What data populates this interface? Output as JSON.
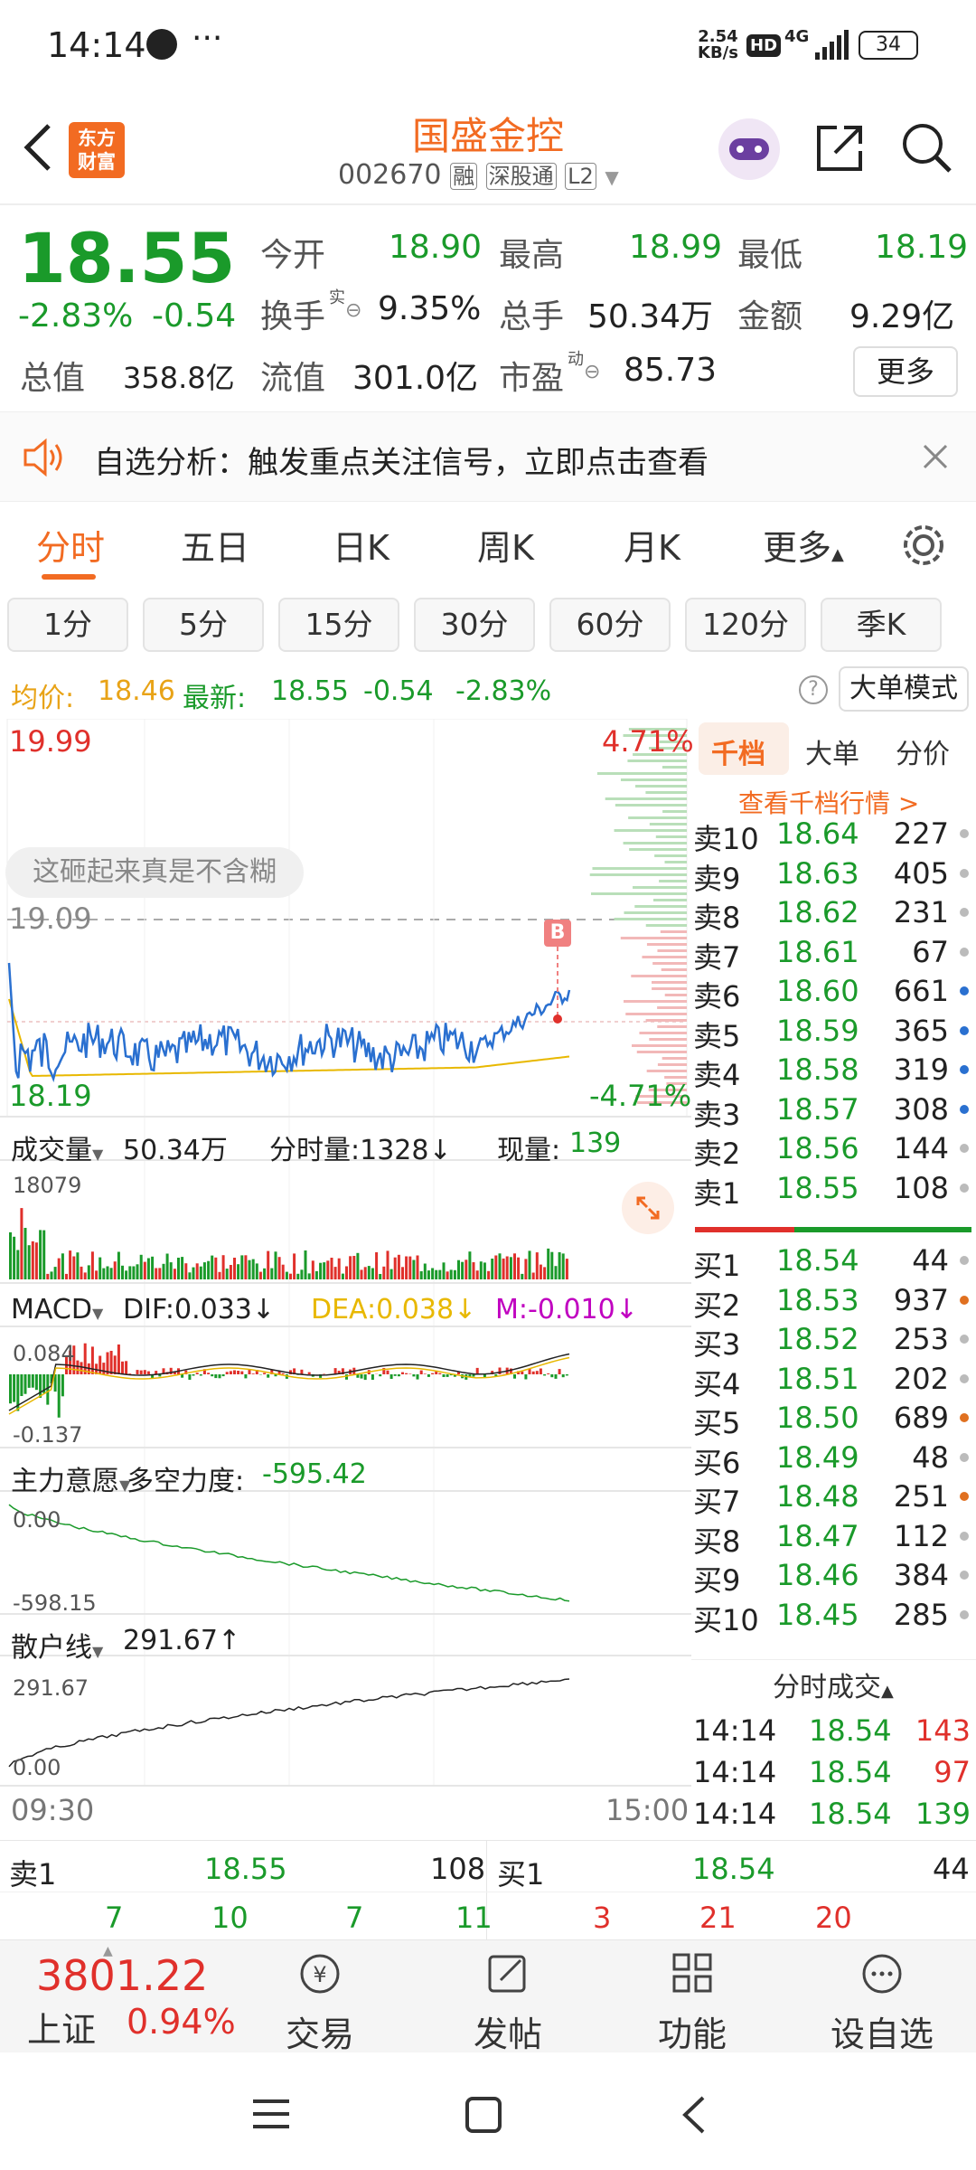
{
  "status_bar": {
    "time": "14:14",
    "net_speed_top": "2.54",
    "net_speed_bottom": "KB/s",
    "hd": "HD",
    "network": "4G",
    "battery": "34"
  },
  "header": {
    "logo_line1": "东方",
    "logo_line2": "财富",
    "title": "国盛金控",
    "code": "002670",
    "tags": [
      "融",
      "深股通",
      "L2"
    ]
  },
  "quote": {
    "price": "18.55",
    "change_pct": "-2.83%",
    "change": "-0.54",
    "open_label": "今开",
    "open": "18.90",
    "high_label": "最高",
    "high": "18.99",
    "low_label": "最低",
    "low": "18.19",
    "turnover_label": "换手",
    "turnover_sup": "实",
    "turnover": "9.35%",
    "volume_label": "总手",
    "volume": "50.34万",
    "amount_label": "金额",
    "amount": "9.29亿",
    "mktcap_label": "总值",
    "mktcap": "358.8亿",
    "float_label": "流值",
    "float": "301.0亿",
    "pe_label": "市盈",
    "pe_sup": "动",
    "pe": "85.73",
    "more": "更多"
  },
  "banner": {
    "text": "自选分析：触发重点关注信号，立即点击查看"
  },
  "tabs": [
    "分时",
    "五日",
    "日K",
    "周K",
    "月K",
    "更多"
  ],
  "pills": [
    "1分",
    "5分",
    "15分",
    "30分",
    "60分",
    "120分",
    "季K"
  ],
  "info_line": {
    "avg_label": "均价:",
    "avg": "18.46",
    "latest_label": "最新:",
    "latest": "18.55",
    "chg": "-0.54",
    "chg_pct": "-2.83%",
    "big_order_mode": "大单模式"
  },
  "chart_data": {
    "type": "line",
    "price_axis": {
      "top": "19.99",
      "mid": "19.09",
      "bottom": "18.19",
      "pct_top": "4.71%",
      "pct_bottom": "-4.71%"
    },
    "time_axis": [
      "09:30",
      "15:00"
    ],
    "comment_bubble": "这砸起来真是不含糊",
    "marker": "B",
    "volume_panel": {
      "label": "成交量",
      "total": "50.34万",
      "time_vol_label": "分时量:1328↓",
      "cur_vol_label": "现量:",
      "cur_vol": "139",
      "max": "18079"
    },
    "macd_panel": {
      "label": "MACD",
      "dif": "DIF:0.033↓",
      "dea": "DEA:0.038↓",
      "m": "M:-0.010↓",
      "max": "0.084",
      "min": "-0.137"
    },
    "main_panel": {
      "label": "主力意愿",
      "force_label": "多空力度:",
      "force": "-595.42",
      "max": "0.00",
      "min": "-598.15"
    },
    "retail_panel": {
      "label": "散户线",
      "value": "291.67↑",
      "max": "291.67",
      "min": "0.00"
    }
  },
  "orderbook": {
    "tabs": [
      "千档",
      "大单",
      "分价"
    ],
    "view_all": "查看千档行情 >",
    "asks": [
      {
        "label": "卖10",
        "price": "18.64",
        "vol": "227"
      },
      {
        "label": "卖9",
        "price": "18.63",
        "vol": "405"
      },
      {
        "label": "卖8",
        "price": "18.62",
        "vol": "231"
      },
      {
        "label": "卖7",
        "price": "18.61",
        "vol": "67"
      },
      {
        "label": "卖6",
        "price": "18.60",
        "vol": "661"
      },
      {
        "label": "卖5",
        "price": "18.59",
        "vol": "365"
      },
      {
        "label": "卖4",
        "price": "18.58",
        "vol": "319"
      },
      {
        "label": "卖3",
        "price": "18.57",
        "vol": "308"
      },
      {
        "label": "卖2",
        "price": "18.56",
        "vol": "144"
      },
      {
        "label": "卖1",
        "price": "18.55",
        "vol": "108"
      }
    ],
    "bids": [
      {
        "label": "买1",
        "price": "18.54",
        "vol": "44"
      },
      {
        "label": "买2",
        "price": "18.53",
        "vol": "937"
      },
      {
        "label": "买3",
        "price": "18.52",
        "vol": "253"
      },
      {
        "label": "买4",
        "price": "18.51",
        "vol": "202"
      },
      {
        "label": "买5",
        "price": "18.50",
        "vol": "689"
      },
      {
        "label": "买6",
        "price": "18.49",
        "vol": "48"
      },
      {
        "label": "买7",
        "price": "18.48",
        "vol": "251"
      },
      {
        "label": "买8",
        "price": "18.47",
        "vol": "112"
      },
      {
        "label": "买9",
        "price": "18.46",
        "vol": "384"
      },
      {
        "label": "买10",
        "price": "18.45",
        "vol": "285"
      }
    ],
    "trades_title": "分时成交",
    "trades": [
      {
        "time": "14:14",
        "price": "18.54",
        "vol": "143"
      },
      {
        "time": "14:14",
        "price": "18.54",
        "vol": "97"
      },
      {
        "time": "14:14",
        "price": "18.54",
        "vol": "139"
      }
    ]
  },
  "bottom_quote": {
    "sell_label": "卖1",
    "sell_price": "18.55",
    "sell_vol": "108",
    "buy_label": "买1",
    "buy_price": "18.54",
    "buy_vol": "44",
    "sell_counts": [
      "7",
      "10",
      "7",
      "11"
    ],
    "buy_counts": [
      "3",
      "21",
      "20"
    ]
  },
  "bottom_nav": {
    "index_value": "3801.22",
    "index_name": "上证",
    "index_chg": "0.94%",
    "items": [
      "交易",
      "发帖",
      "功能",
      "设自选"
    ]
  }
}
